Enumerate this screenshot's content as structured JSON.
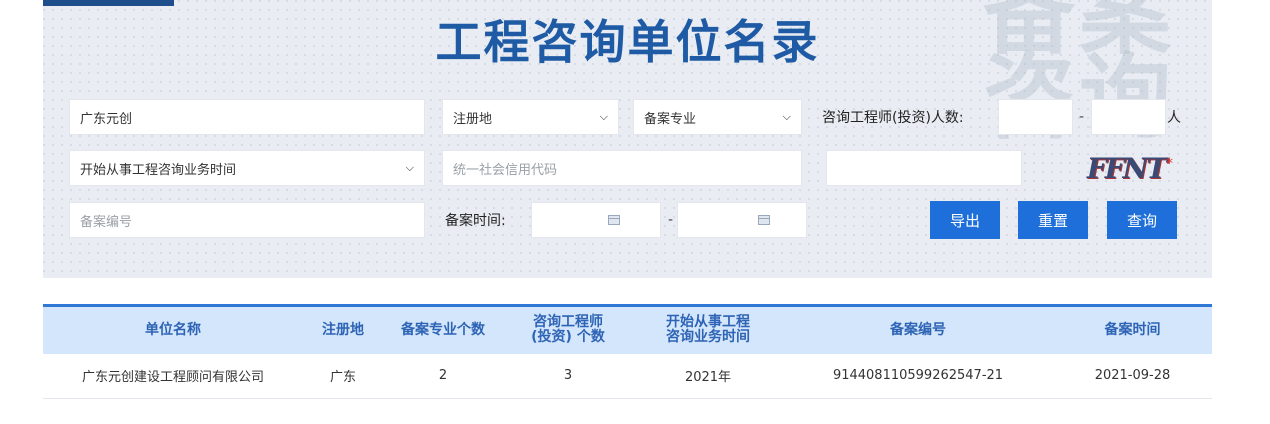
{
  "page": {
    "title": "工程咨询单位名录",
    "watermark": "备案咨询"
  },
  "filters": {
    "company_value": "广东元创",
    "region_select": "注册地",
    "specialty_select": "备案专业",
    "engineer_count_label": "咨询工程师(投资)人数:",
    "engineer_count_unit": "人",
    "range_dash": "-",
    "start_time_select": "开始从事工程咨询业务时间",
    "credit_code_placeholder": "统一社会信用代码",
    "record_no_placeholder": "备案编号",
    "record_time_label": "备案时间:",
    "captcha_text": "FFNT",
    "required_mark": "*"
  },
  "buttons": {
    "export": "导出",
    "reset": "重置",
    "search": "查询"
  },
  "table": {
    "headers": {
      "name": "单位名称",
      "region": "注册地",
      "specialty_count": "备案专业个数",
      "engineer_count_1": "咨询工程师",
      "engineer_count_2": "(投资) 个数",
      "start_time_1": "开始从事工程",
      "start_time_2": "咨询业务时间",
      "record_no": "备案编号",
      "record_time": "备案时间"
    },
    "rows": [
      {
        "name": "广东元创建设工程顾问有限公司",
        "region": "广东",
        "specialty_count": "2",
        "engineer_count": "3",
        "start_time": "2021年",
        "record_no": "914408110599262547-21",
        "record_time": "2021-09-28"
      }
    ]
  },
  "colors": {
    "accent": "#1e6fd9",
    "title": "#1f5ba5",
    "header_bg": "#d4e6fb",
    "header_text": "#2e64b5"
  }
}
